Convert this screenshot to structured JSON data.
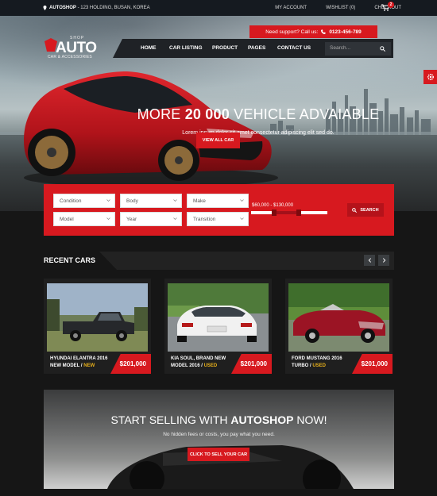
{
  "topbar": {
    "brand": "AUTOSHOP",
    "address": " - 123 HOLDING, BUSAN, KOREA",
    "links": [
      "MY ACCOUNT",
      "WISHLIST (0)",
      "CHECKOUT"
    ],
    "cart_count": "2"
  },
  "logo": {
    "top": "SHOP",
    "main": "AUTO",
    "sub": "CAR & ACCESSORIES"
  },
  "support": {
    "label": "Need support? Call us:",
    "phone": "0123-456-789"
  },
  "nav": {
    "items": [
      "HOME",
      "CAR LISTING",
      "PRODUCT",
      "PAGES",
      "CONTACT US"
    ],
    "search_placeholder": "Search..."
  },
  "hero": {
    "title_pre": "MORE ",
    "title_bold": "20 000",
    "title_post": " VEHICLE ADVAIABLE",
    "subtitle": "Lorem ipsum dolor sit amet consectetur adipiscing elit sed do.",
    "button": "VIEW ALL CAR"
  },
  "search_panel": {
    "filters": [
      "Condition",
      "Body",
      "Make",
      "Model",
      "Year",
      "Transition"
    ],
    "price_range": "$60,000 - $130,000",
    "range_low_fraction": 0.3,
    "range_high_fraction": 0.62,
    "button": "SEARCH"
  },
  "recent": {
    "title": "RECENT CARS",
    "cars": [
      {
        "name": "HYUNDAI ELANTRA 2016",
        "line2": "NEW MODEL / ",
        "tag": "NEW",
        "price": "$201,000"
      },
      {
        "name": "KIA SOUL, BRAND NEW",
        "line2": "MODEL 2016 / ",
        "tag": "USED",
        "price": "$201,000"
      },
      {
        "name": "FORD MUSTANG 2016",
        "line2": "TURBO / ",
        "tag": "USED",
        "price": "$201,000"
      }
    ]
  },
  "sell": {
    "title_pre": "START SELLING WITH ",
    "title_bold": "AUTOSHOP",
    "title_post": " NOW!",
    "subtitle": "No hidden fees or costs, you pay what you need.",
    "button": "CLICK TO SELL YOUR CAR"
  },
  "colors": {
    "accent": "#d7191f",
    "tag": "#e8b01a",
    "background": "#161616"
  }
}
